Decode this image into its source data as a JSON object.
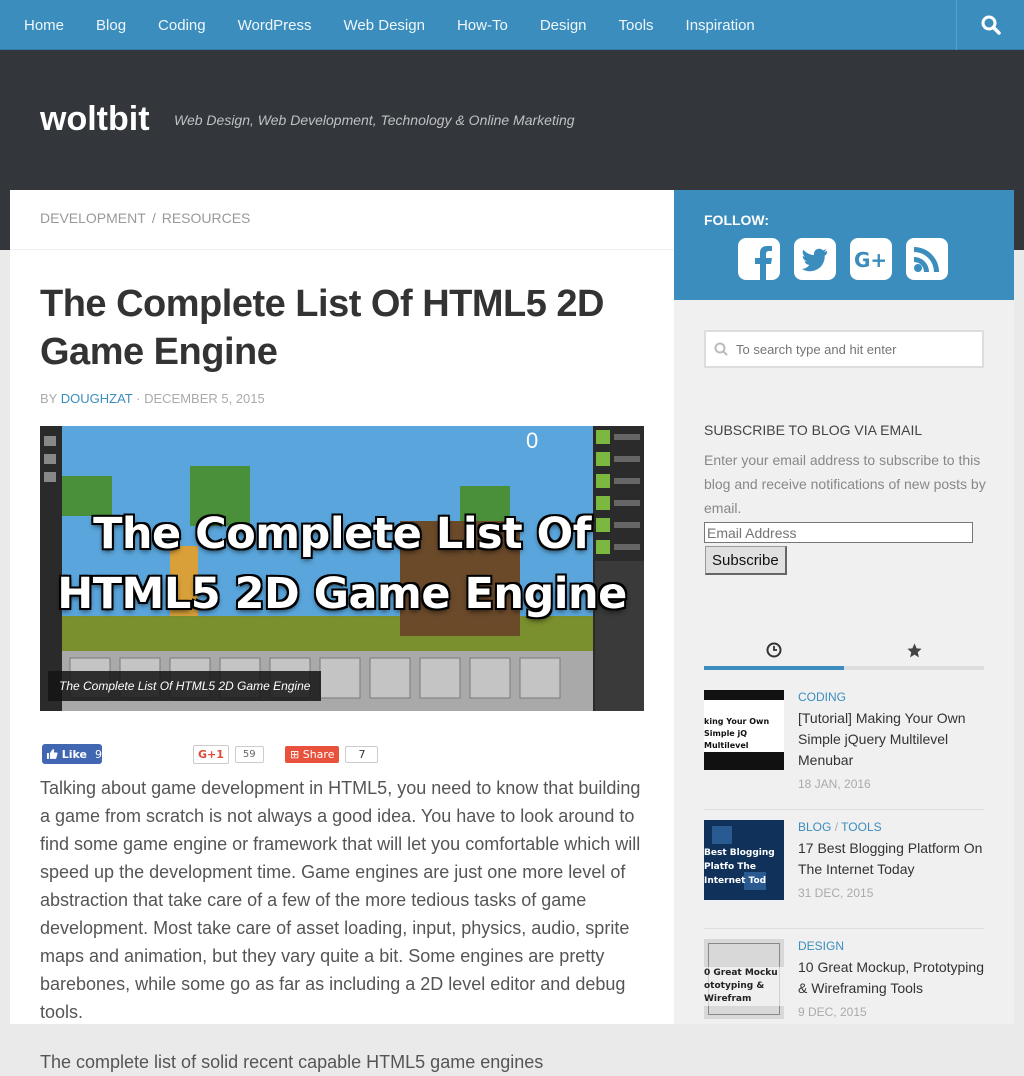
{
  "nav": {
    "items": [
      "Home",
      "Blog",
      "Coding",
      "WordPress",
      "Web Design",
      "How-To",
      "Design",
      "Tools",
      "Inspiration"
    ],
    "search_icon": "search-icon"
  },
  "header": {
    "site_title": "woltbit",
    "tagline": "Web Design, Web Development, Technology & Online Marketing"
  },
  "breadcrumb": {
    "cat1": "Development",
    "sep": "/",
    "cat2": "Resources"
  },
  "post": {
    "title": "The Complete List Of HTML5 2D Game Engine",
    "by": "by",
    "author": "doughzat",
    "dot": "·",
    "date": "December 5, 2015",
    "image_text_line1": "The Complete List Of",
    "image_text_line2": "HTML5 2D Game Engine",
    "image_counter": "0",
    "image_caption": "The Complete List Of HTML5 2D Game Engine",
    "paragraph1": "Talking about game development in HTML5, you need to know that building a game from scratch is not always a good idea. You have to look around to find some game engine or framework that will let you comfortable which will speed up the development time. Game engines are just one more level of abstraction that take care of a few of the more tedious tasks of game development. Most take care of asset loading, input, physics, audio, sprite maps and animation, but they vary quite a bit. Some engines are pretty barebones, while some go as far as including a 2D level editor and debug tools.",
    "paragraph2": "The complete list of solid recent capable HTML5 game engines"
  },
  "social": {
    "fb_label": "Like",
    "fb_count": "9",
    "gplus_label": "G+1",
    "gplus_count": "59",
    "share_label": "Share",
    "share_count": "7"
  },
  "sidebar": {
    "follow_label": "Follow:",
    "follow_icons": [
      "facebook-icon",
      "twitter-icon",
      "google-plus-icon",
      "rss-icon"
    ],
    "search_placeholder": "To search type and hit enter",
    "subscribe_title": "Subscribe to Blog via Email",
    "subscribe_desc": "Enter your email address to subscribe to this blog and receive notifications of new posts by email.",
    "email_placeholder": "Email Address",
    "subscribe_button": "Subscribe",
    "tabs": [
      "clock-icon",
      "star-icon"
    ],
    "posts": [
      {
        "cat1": "Coding",
        "cat2": "",
        "title": "[Tutorial] Making Your Own Simple jQuery Multilevel Menubar",
        "date": "18 Jan, 2016",
        "thumb_text": "king Your Own Simple jQ Multilevel Menuba"
      },
      {
        "cat1": "Blog",
        "cat2": "Tools",
        "title": "17 Best Blogging Platform On The Internet Today",
        "date": "31 Dec, 2015",
        "thumb_text": "Best Blogging Platfo The Internet Tod"
      },
      {
        "cat1": "Design",
        "cat2": "",
        "title": "10 Great Mockup, Prototyping & Wireframing Tools",
        "date": "9 Dec, 2015",
        "thumb_text": "0 Great Mocku ototyping & Wirefram"
      }
    ]
  },
  "colors": {
    "accent": "#3b8dbd",
    "header_bg": "#33363b",
    "page_bg": "#eaeaea"
  }
}
